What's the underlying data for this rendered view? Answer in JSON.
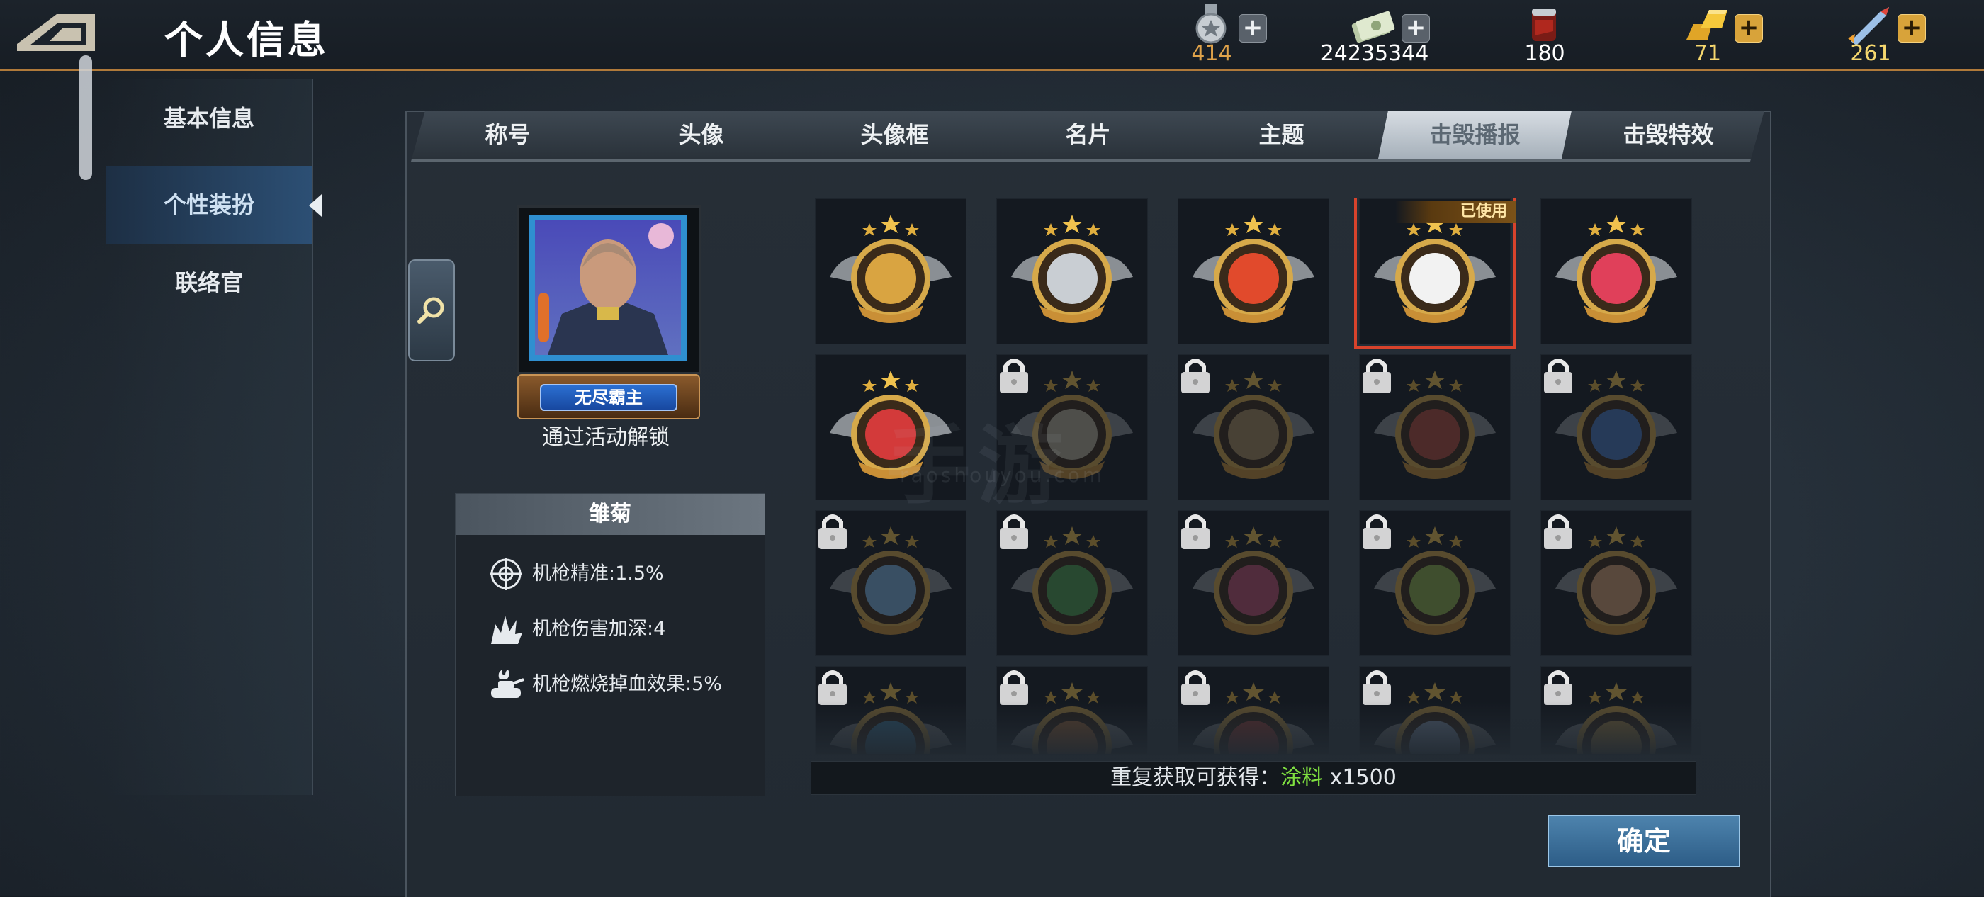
{
  "header": {
    "title": "个人信息",
    "back_icon": "back-arrow-icon"
  },
  "resources": [
    {
      "name": "medal",
      "icon": "silver-medal-icon",
      "value": "414",
      "color": "#e0a34a",
      "plus_style": "grey"
    },
    {
      "name": "cash",
      "icon": "banknotes-icon",
      "value": "24235344",
      "color": "#ffffff",
      "plus_style": "grey"
    },
    {
      "name": "paint",
      "icon": "paint-bucket-icon",
      "value": "180",
      "color": "#ffffff",
      "plus_style": "none"
    },
    {
      "name": "gold",
      "icon": "gold-bars-icon",
      "value": "71",
      "color": "#f5d76e",
      "plus_style": "gold"
    },
    {
      "name": "token",
      "icon": "missile-icon",
      "value": "261",
      "color": "#f5d76e",
      "plus_style": "gold"
    }
  ],
  "sidebar": {
    "items": [
      {
        "label": "基本信息"
      },
      {
        "label": "个性装扮"
      },
      {
        "label": "联络官"
      }
    ],
    "active_index": 1
  },
  "tabs": {
    "items": [
      "称号",
      "头像",
      "头像框",
      "名片",
      "主题",
      "击毁播报",
      "击毁特效"
    ],
    "active_index": 5
  },
  "preview": {
    "name_plate": "无尽霸主",
    "unlock_hint": "通过活动解锁"
  },
  "attributes": {
    "title": "雏菊",
    "items": [
      {
        "icon": "crosshair-icon",
        "text": "机枪精准:1.5%"
      },
      {
        "icon": "explosion-icon",
        "text": "机枪伤害加深:4"
      },
      {
        "icon": "burning-tank-icon",
        "text": "机枪燃烧掉血效果:5%"
      }
    ]
  },
  "badges": {
    "in_use_label": "已使用",
    "items": [
      {
        "name": "gold-star-badge",
        "locked": false,
        "in_use": false,
        "accent": "#d9a441"
      },
      {
        "name": "winged-shield-badge",
        "locked": false,
        "in_use": false,
        "accent": "#c9ced3"
      },
      {
        "name": "lightning-badge",
        "locked": false,
        "in_use": false,
        "accent": "#e14a2c"
      },
      {
        "name": "daisy-badge",
        "locked": false,
        "in_use": true,
        "accent": "#f2f2f2"
      },
      {
        "name": "heart-badge",
        "locked": false,
        "in_use": false,
        "accent": "#e0405a"
      },
      {
        "name": "red-star-shield-badge",
        "locked": false,
        "in_use": false,
        "accent": "#d33a3a"
      },
      {
        "name": "locked-badge-07",
        "locked": true,
        "in_use": false,
        "accent": "#b9b09a"
      },
      {
        "name": "locked-badge-08",
        "locked": true,
        "in_use": false,
        "accent": "#a88c5c"
      },
      {
        "name": "locked-badge-09",
        "locked": true,
        "in_use": false,
        "accent": "#b44a3a"
      },
      {
        "name": "locked-badge-10",
        "locked": true,
        "in_use": false,
        "accent": "#4a78c0"
      },
      {
        "name": "locked-snowflake-badge",
        "locked": true,
        "in_use": false,
        "accent": "#7fb3e0"
      },
      {
        "name": "locked-badge-12",
        "locked": true,
        "in_use": false,
        "accent": "#4fa050"
      },
      {
        "name": "locked-badge-13",
        "locked": true,
        "in_use": false,
        "accent": "#c05070"
      },
      {
        "name": "locked-badge-14",
        "locked": true,
        "in_use": false,
        "accent": "#8fb04a"
      },
      {
        "name": "locked-badge-15",
        "locked": true,
        "in_use": false,
        "accent": "#d6a070"
      },
      {
        "name": "locked-badge-16",
        "locked": true,
        "in_use": false,
        "accent": "#4a90b8"
      },
      {
        "name": "locked-badge-17",
        "locked": true,
        "in_use": false,
        "accent": "#c07a40"
      },
      {
        "name": "locked-badge-18",
        "locked": true,
        "in_use": false,
        "accent": "#b84a40"
      },
      {
        "name": "locked-badge-19",
        "locked": true,
        "in_use": false,
        "accent": "#9ab0d0"
      },
      {
        "name": "locked-badge-20",
        "locked": true,
        "in_use": false,
        "accent": "#c9a050"
      }
    ]
  },
  "repeat_reward": {
    "prefix": "重复获取可获得：",
    "item": "涂料",
    "amount": "x1500"
  },
  "confirm_label": "确定",
  "watermark": {
    "main": "手游",
    "sub": "raoshouyou.com"
  }
}
